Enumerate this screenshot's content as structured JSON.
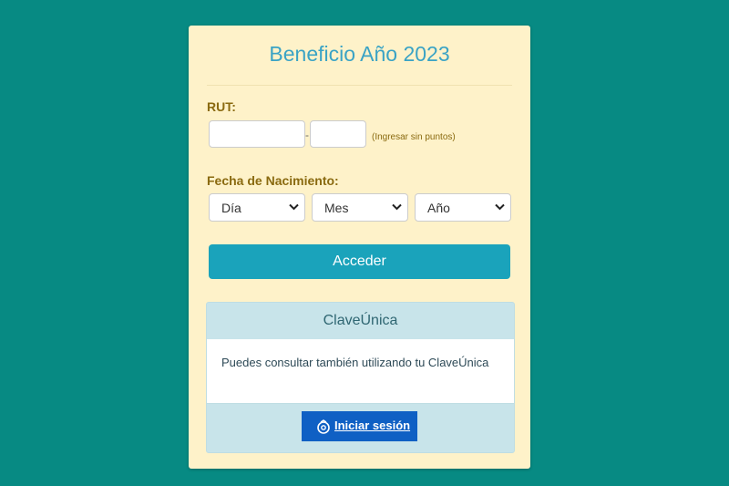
{
  "form": {
    "title": "Beneficio Año 2023",
    "rut_label": "RUT:",
    "rut_value": "",
    "rut_dv_value": "",
    "rut_separator": "-",
    "rut_hint": "(Ingresar sin puntos)",
    "birth_label": "Fecha de Nacimiento:",
    "day_selected": "Día",
    "month_selected": "Mes",
    "year_selected": "Año",
    "submit_label": "Acceder"
  },
  "clave_unica": {
    "header": "ClaveÚnica",
    "message": "Puedes consultar también utilizando tu ClaveÚnica",
    "login_label": "Iniciar sesión"
  },
  "colors": {
    "background": "#078a83",
    "card": "#fef2c9",
    "primary_button": "#1aa3bb",
    "clave_button": "#0f60c4"
  }
}
